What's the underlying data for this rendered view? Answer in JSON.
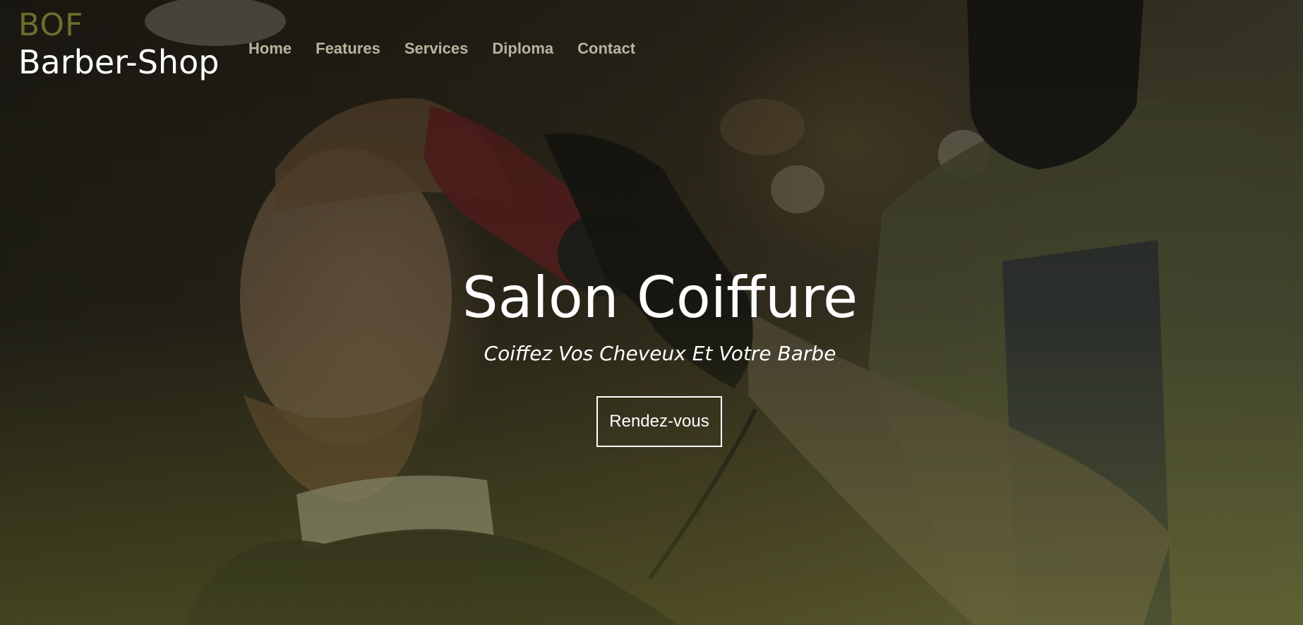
{
  "brand": {
    "top": "BOF",
    "bottom": "Barber-Shop"
  },
  "nav": {
    "items": [
      {
        "label": "Home"
      },
      {
        "label": "Features"
      },
      {
        "label": "Services"
      },
      {
        "label": "Diploma"
      },
      {
        "label": "Contact"
      }
    ]
  },
  "hero": {
    "title": "Salon Coiffure",
    "subtitle": "Coiffez Vos Cheveux Et Votre Barbe",
    "cta_label": "Rendez-vous"
  },
  "colors": {
    "brand_top": "#6d6d2c",
    "nav_text": "#b9b39f",
    "text": "#ffffff"
  }
}
